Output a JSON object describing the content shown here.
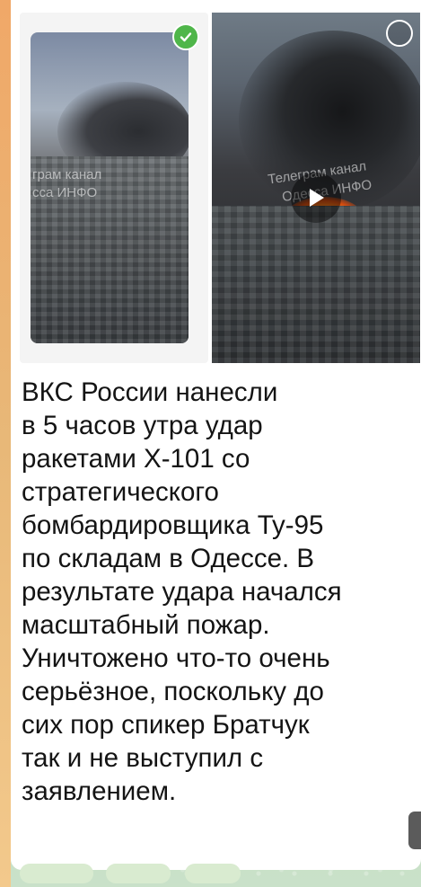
{
  "media": {
    "photo": {
      "watermark_line1": "грам канал",
      "watermark_line2": "сса ИНФО"
    },
    "video": {
      "watermark_line1": "Телеграм канал",
      "watermark_line2": "Одесса ИНФО"
    }
  },
  "message": {
    "text": "ВКС России нанесли\nв 5 часов утра удар\nракетами Х-101 со\nстратегического\nбомбардировщика Ту-95\nпо складам в Одессе. В\nрезультате удара начался\nмасштабный пожар.\nУничтожено что-то очень\nсерьёзное, поскольку до\nсих пор спикер Братчук\nтак и не выступил с\nзаявлением."
  },
  "colors": {
    "accent_green": "#4fb64a",
    "bubble_bg": "#ffffff",
    "text": "#141414"
  }
}
